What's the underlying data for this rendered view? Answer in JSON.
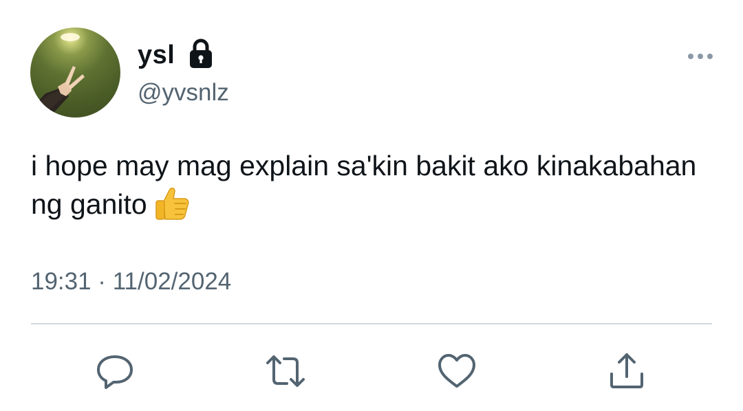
{
  "user": {
    "display_name": "ysl",
    "handle": "@yvsnlz",
    "protected_icon": "lock-icon",
    "avatar_icon": "avatar"
  },
  "tweet": {
    "text": "i hope may mag explain sa'kin bakit ako kinakabahan ng ganito",
    "emoji_icon": "thumbs-up-icon",
    "timestamp": "19:31 · 11/02/2024"
  },
  "actions": {
    "reply_icon": "reply-icon",
    "retweet_icon": "retweet-icon",
    "like_icon": "heart-icon",
    "share_icon": "share-icon",
    "more_icon": "more-options-icon"
  },
  "colors": {
    "primary_text": "#0f1419",
    "secondary_text": "#536471",
    "divider": "#cfd9de",
    "background": "#ffffff"
  }
}
